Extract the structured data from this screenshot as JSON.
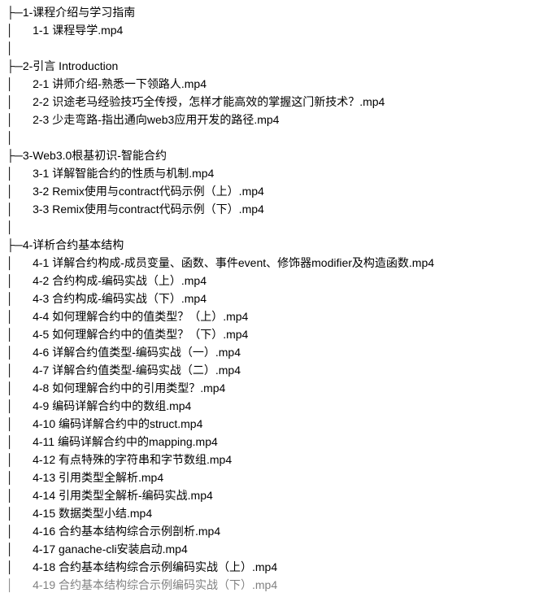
{
  "sections": [
    {
      "folder_prefix": "├─",
      "folder": "1-课程介绍与学习指南",
      "items": [
        {
          "prefix": "│      ",
          "name": "1-1 课程导学.mp4"
        }
      ],
      "trail": "│"
    },
    {
      "folder_prefix": "├─",
      "folder": "2-引言 Introduction",
      "items": [
        {
          "prefix": "│      ",
          "name": "2-1 讲师介绍-熟悉一下领路人.mp4"
        },
        {
          "prefix": "│      ",
          "name": "2-2 识途老马经验技巧全传授，怎样才能高效的掌握这门新技术？.mp4"
        },
        {
          "prefix": "│      ",
          "name": "2-3 少走弯路-指出通向web3应用开发的路径.mp4"
        }
      ],
      "trail": "│"
    },
    {
      "folder_prefix": "├─",
      "folder": "3-Web3.0根基初识-智能合约",
      "items": [
        {
          "prefix": "│      ",
          "name": "3-1 详解智能合约的性质与机制.mp4"
        },
        {
          "prefix": "│      ",
          "name": "3-2 Remix使用与contract代码示例（上）.mp4"
        },
        {
          "prefix": "│      ",
          "name": "3-3 Remix使用与contract代码示例（下）.mp4"
        }
      ],
      "trail": "│"
    },
    {
      "folder_prefix": "├─",
      "folder": "4-详析合约基本结构",
      "items": [
        {
          "prefix": "│      ",
          "name": "4-1 详解合约构成-成员变量、函数、事件event、修饰器modifier及构造函数.mp4"
        },
        {
          "prefix": "│      ",
          "name": "4-2 合约构成-编码实战（上）.mp4"
        },
        {
          "prefix": "│      ",
          "name": "4-3 合约构成-编码实战（下）.mp4"
        },
        {
          "prefix": "│      ",
          "name": "4-4 如何理解合约中的值类型？（上）.mp4"
        },
        {
          "prefix": "│      ",
          "name": "4-5 如何理解合约中的值类型？（下）.mp4"
        },
        {
          "prefix": "│      ",
          "name": "4-6 详解合约值类型-编码实战（一）.mp4"
        },
        {
          "prefix": "│      ",
          "name": "4-7 详解合约值类型-编码实战（二）.mp4"
        },
        {
          "prefix": "│      ",
          "name": "4-8 如何理解合约中的引用类型？.mp4"
        },
        {
          "prefix": "│      ",
          "name": "4-9 编码详解合约中的数组.mp4"
        },
        {
          "prefix": "│      ",
          "name": "4-10 编码详解合约中的struct.mp4"
        },
        {
          "prefix": "│      ",
          "name": "4-11 编码详解合约中的mapping.mp4"
        },
        {
          "prefix": "│      ",
          "name": "4-12 有点特殊的字符串和字节数组.mp4"
        },
        {
          "prefix": "│      ",
          "name": "4-13 引用类型全解析.mp4"
        },
        {
          "prefix": "│      ",
          "name": "4-14 引用类型全解析-编码实战.mp4"
        },
        {
          "prefix": "│      ",
          "name": "4-15 数据类型小结.mp4"
        },
        {
          "prefix": "│      ",
          "name": "4-16 合约基本结构综合示例剖析.mp4"
        },
        {
          "prefix": "│      ",
          "name": "4-17 ganache-cli安装启动.mp4"
        },
        {
          "prefix": "│      ",
          "name": "4-18 合约基本结构综合示例编码实战（上）.mp4"
        },
        {
          "prefix": "│      ",
          "name": "4-19 合约基本结构综合示例编码实战（下）.mp4",
          "cutoff": true
        }
      ]
    }
  ]
}
